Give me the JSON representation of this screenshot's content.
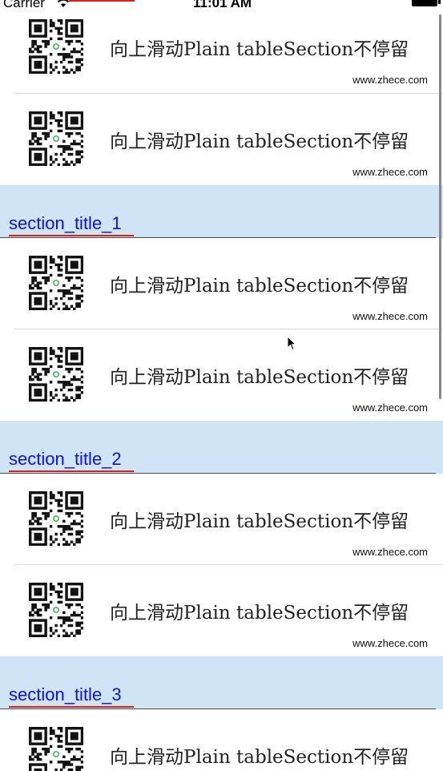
{
  "status_bar": {
    "carrier": "Carrier",
    "time": "11:01 AM"
  },
  "cell_texts": {
    "title": "向上滑动Plain tableSection不停留",
    "site": "www.zhece.com"
  },
  "sections": [
    {
      "title": ""
    },
    {
      "title": "section_title_1"
    },
    {
      "title": "section_title_2"
    },
    {
      "title": "section_title_3"
    }
  ],
  "colors": {
    "section_header_bg": "#cfe4f5",
    "section_title": "#1010e6",
    "underline_accent": "#e21b1b"
  },
  "icons": {
    "qr": "qr-code-icon",
    "wifi": "wifi-icon",
    "battery": "battery-icon",
    "cursor": "mouse-cursor-icon"
  }
}
